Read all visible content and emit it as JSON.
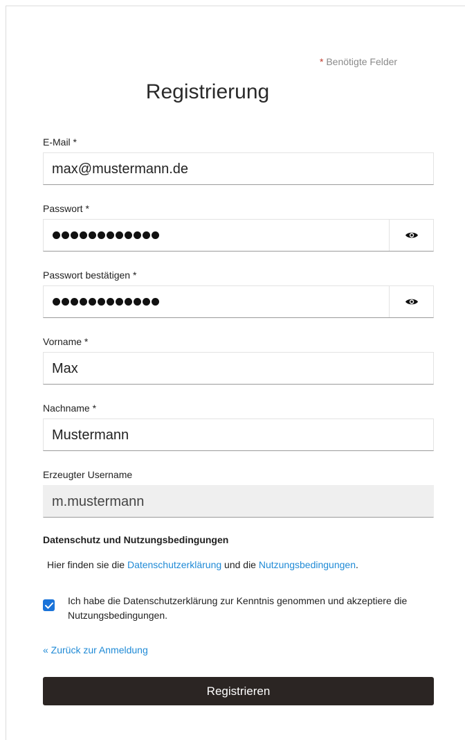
{
  "required_note": {
    "star": "*",
    "text": "Benötigte Felder"
  },
  "title": "Registrierung",
  "fields": {
    "email": {
      "label": "E-Mail *",
      "value": "max@mustermann.de"
    },
    "password": {
      "label": "Passwort *",
      "masked_length": 12
    },
    "password_confirm": {
      "label": "Passwort bestätigen *",
      "masked_length": 12
    },
    "firstname": {
      "label": "Vorname *",
      "value": "Max"
    },
    "lastname": {
      "label": "Nachname *",
      "value": "Mustermann"
    },
    "username": {
      "label": "Erzeugter Username",
      "value": "m.mustermann"
    }
  },
  "privacy": {
    "heading": "Datenschutz und Nutzungsbedingungen",
    "text_before": "Hier finden sie die",
    "privacy_link": "Datenschutzerklärung",
    "text_middle": "und die",
    "terms_link": "Nutzungsbedingungen",
    "text_after": ".",
    "consent": "Ich habe die Datenschutzerklärung zur Kenntnis genommen und akzeptiere die Nutzungsbedingungen.",
    "consent_checked": true
  },
  "back_link": "« Zurück zur Anmeldung",
  "submit_label": "Registrieren",
  "colors": {
    "link": "#1f8ad6",
    "button": "#2b2523",
    "checkbox": "#1a73d9",
    "required_star": "#c0392b"
  },
  "icons": {
    "toggle_visibility": "eye-icon",
    "checkbox_mark": "checkmark-icon"
  }
}
